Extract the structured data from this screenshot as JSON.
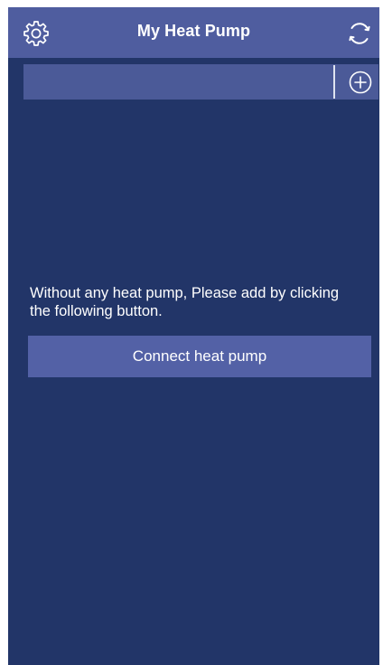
{
  "header": {
    "title": "My Heat Pump",
    "settings_icon": "gear-icon",
    "refresh_icon": "refresh-icon"
  },
  "device_bar": {
    "devices": [],
    "add_icon": "circle-plus-icon"
  },
  "empty_state": {
    "message": "Without any heat pump, Please add by clicking the following button.",
    "button_label": "Connect heat pump"
  },
  "colors": {
    "background": "#223568",
    "header": "#4f5d9f",
    "bar": "#4b5a98",
    "button": "#5361a6",
    "text": "#ffffff"
  }
}
